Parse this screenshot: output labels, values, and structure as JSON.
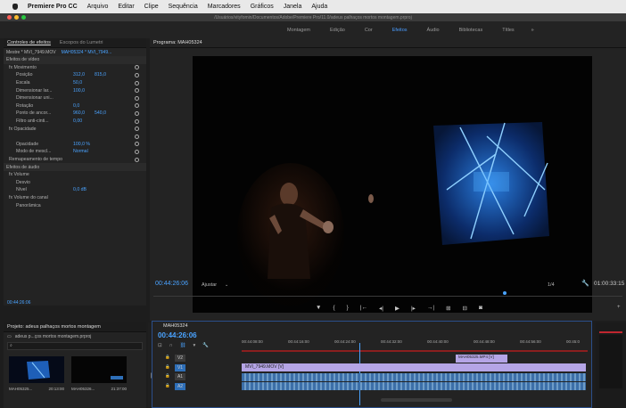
{
  "menubar": {
    "app": "Premiere Pro CC",
    "items": [
      "Arquivo",
      "Editar",
      "Clipe",
      "Sequência",
      "Marcadores",
      "Gráficos",
      "Janela",
      "Ajuda"
    ]
  },
  "titlebar": {
    "path": "/Usuários/vityfomin/Documentos/Adobe/Premiere Pro/11.0/adeus palhaços mortos montagem.prproj"
  },
  "workspaces": {
    "tabs": [
      "Montagem",
      "Edição",
      "Cor",
      "Efeitos",
      "Áudio",
      "Bibliotecas",
      "Títles"
    ],
    "active": "Efeitos",
    "more": "»"
  },
  "effects_panel": {
    "tabs": [
      "Controles de efeitos",
      "Escopos do Lumetri"
    ],
    "master": "Mestre * MVI_7949.MOV",
    "clip": "MAH05324 * MVI_7949...",
    "video_section": "Efeitos de vídeo",
    "rows": [
      {
        "label": "fx  Movimento",
        "v1": "",
        "v2": ""
      },
      {
        "label": "Posição",
        "v1": "312,0",
        "v2": "815,0"
      },
      {
        "label": "Escala",
        "v1": "50,0",
        "v2": ""
      },
      {
        "label": "Dimensionar lar...",
        "v1": "100,0",
        "v2": ""
      },
      {
        "label": "Dimensionar uni...",
        "v1": "",
        "v2": ""
      },
      {
        "label": "Rotação",
        "v1": "0,0",
        "v2": ""
      },
      {
        "label": "Ponto de ancor...",
        "v1": "960,0",
        "v2": "540,0"
      },
      {
        "label": "Filtro anti-cinti...",
        "v1": "0,00",
        "v2": ""
      },
      {
        "label": "fx  Opacidade",
        "v1": "",
        "v2": ""
      },
      {
        "label": "",
        "v1": "",
        "v2": ""
      },
      {
        "label": "Opacidade",
        "v1": "100,0 %",
        "v2": ""
      },
      {
        "label": "Modo de mescl...",
        "v1": "Normal",
        "v2": ""
      },
      {
        "label": "Remapeamento de tempo",
        "v1": "",
        "v2": ""
      }
    ],
    "audio_section": "Efeitos de áudio",
    "audio_rows": [
      {
        "label": "fx  Volume",
        "v1": ""
      },
      {
        "label": "Desvio",
        "v1": ""
      },
      {
        "label": "Nível",
        "v1": "0,0 dB"
      },
      {
        "label": "fx  Volume do canal",
        "v1": ""
      },
      {
        "label": "Panorâmica",
        "v1": ""
      }
    ],
    "timecode": "00:44:26:06"
  },
  "program": {
    "tab": "Programa: MAH05324",
    "timecode": "00:44:26:06",
    "fit": "Ajustar",
    "quality": "1/4",
    "duration": "01:00:33:15"
  },
  "project": {
    "tab": "Projeto: adeus palhaços mortos montagem",
    "file": "adeus p...ços mortos montagem.prproj",
    "thumbs": [
      {
        "label": "MAH05325...",
        "dur": "20:13:00"
      },
      {
        "label": "MAH05326...",
        "dur": "21:37:00"
      }
    ]
  },
  "timeline": {
    "tab": "MAH05324",
    "timecode": "00:44:26:06",
    "ruler": [
      "00:44:08:00",
      "00:44:16:00",
      "00:44:24:00",
      "00:44:32:00",
      "00:44:40:00",
      "00:44:48:00",
      "00:44:56:00",
      "00:45:0"
    ],
    "tracks": [
      {
        "name": "V2",
        "clip": ""
      },
      {
        "name": "V1",
        "clip": "MVI_7949.MOV [V]"
      },
      {
        "name": "A1",
        "clip": ""
      },
      {
        "name": "A2",
        "clip": ""
      }
    ],
    "v2_clip_label": "MAH05325.MP4 [V]"
  },
  "colors": {
    "accent": "#4aa3ff",
    "active_blue": "#2e6fb8"
  }
}
